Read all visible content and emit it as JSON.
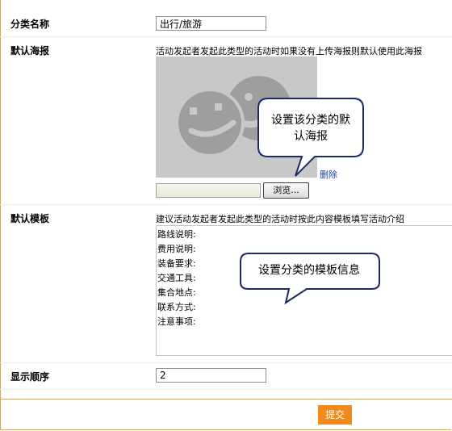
{
  "form": {
    "category_name": {
      "label": "分类名称",
      "value": "出行/旅游"
    },
    "default_poster": {
      "label": "默认海报",
      "hint": "活动发起者发起此类型的活动时如果没有上传海报则默认使用此海报",
      "browse_label": "浏览...",
      "delete_label": "删除"
    },
    "default_template": {
      "label": "默认模板",
      "hint": "建议活动发起者发起此类型的活动时按此内容模板填写活动介绍",
      "lines": [
        "路线说明:",
        "费用说明:",
        "装备要求:",
        "交通工具:",
        "集合地点:",
        "联系方式:",
        "注意事项:"
      ]
    },
    "display_order": {
      "label": "显示顺序",
      "value": "2"
    },
    "submit_label": "提交"
  },
  "callouts": {
    "poster_line1": "设置该分类的默",
    "poster_line2": "认海报",
    "template": "设置分类的模板信息"
  },
  "colors": {
    "accent": "#f08a1c",
    "frame": "#e8a33c",
    "callout_border": "#1c2a6b",
    "link": "#1a44a8"
  },
  "icons": {
    "poster_placeholder": "smiley-faces-icon"
  }
}
